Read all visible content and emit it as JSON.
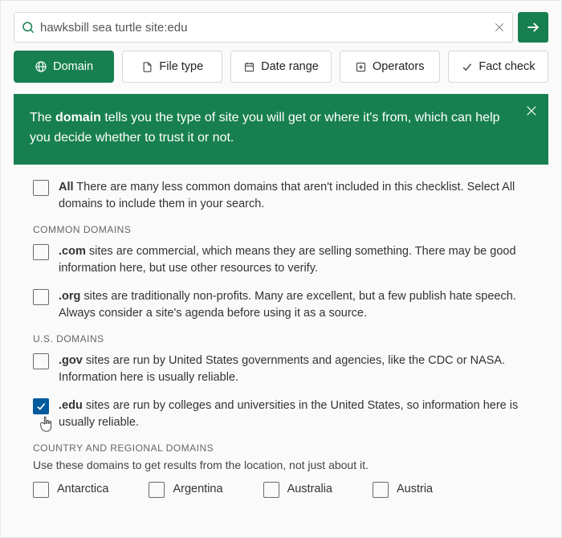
{
  "search": {
    "value": "hawksbill sea turtle site:edu"
  },
  "tabs": {
    "domain": "Domain",
    "filetype": "File type",
    "daterange": "Date range",
    "operators": "Operators",
    "factcheck": "Fact check"
  },
  "banner": {
    "prefix": "The ",
    "bold": "domain",
    "rest": " tells you the type of site you will get or where it's from, which can help you decide whether to trust it or not."
  },
  "sections": {
    "common_label": "COMMON DOMAINS",
    "us_label": "U.S. DOMAINS",
    "country_label": "COUNTRY AND REGIONAL DOMAINS",
    "country_sub": "Use these domains to get results from the location, not just about it."
  },
  "options": {
    "all": {
      "title": "All",
      "desc": " There are many less common domains that aren't included in this checklist. Select All domains to include them in your search."
    },
    "com": {
      "title": ".com",
      "desc": " sites are commercial, which means they are selling something. There may be good information here, but use other resources to verify."
    },
    "org": {
      "title": ".org",
      "desc": " sites are traditionally non-profits. Many are excellent, but a few publish hate speech. Always consider a site's agenda before using it as a source."
    },
    "gov": {
      "title": ".gov",
      "desc": " sites are run by United States governments and agencies, like the CDC or NASA. Information here is usually reliable."
    },
    "edu": {
      "title": ".edu",
      "desc": " sites are run by colleges and universities in the United States, so information here is usually reliable."
    }
  },
  "countries": {
    "ant": "Antarctica",
    "arg": "Argentina",
    "aus": "Australia",
    "aut": "Austria"
  }
}
